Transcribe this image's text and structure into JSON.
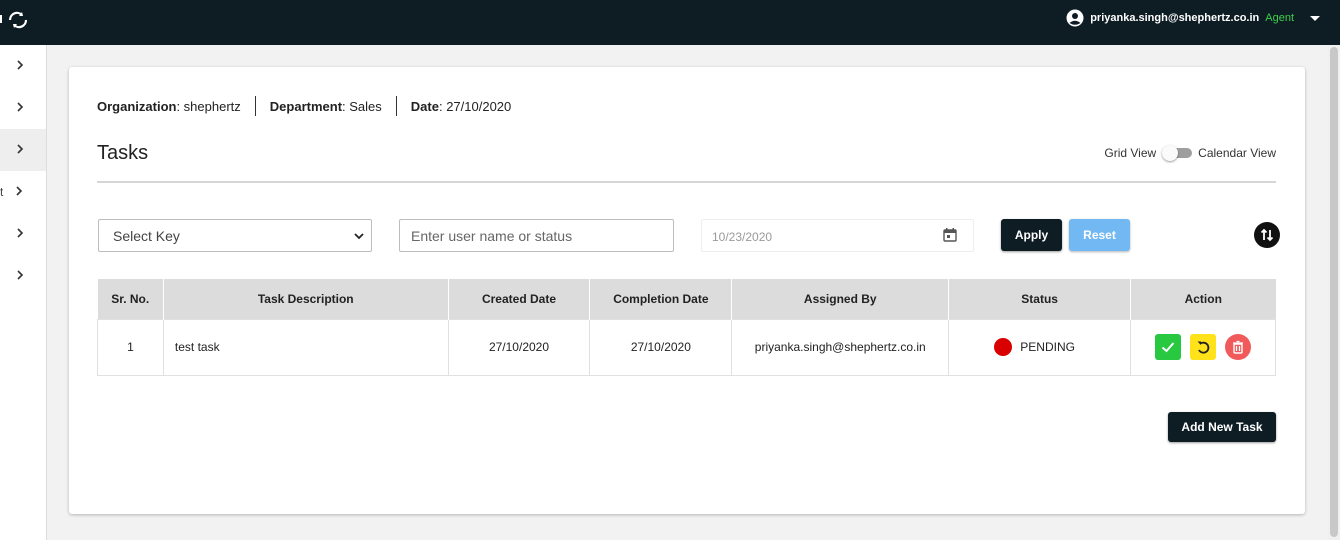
{
  "topbar": {
    "logo_icon": "sync-icon",
    "user_icon": "account-circle-icon",
    "user_email": "priyanka.singh@shephertz.co.in",
    "user_role": "Agent",
    "menu_icon": "caret-down-icon",
    "role_color": "#3ecf4c",
    "bg_color": "#0e1c24"
  },
  "sidebar": {
    "items": [
      {
        "icon": "chevron-right-icon",
        "label_fragment": "",
        "active": false
      },
      {
        "icon": "chevron-right-icon",
        "label_fragment": "",
        "active": false
      },
      {
        "icon": "chevron-right-icon",
        "label_fragment": "",
        "active": true
      },
      {
        "icon": "chevron-right-icon",
        "label_fragment": "t",
        "active": false
      },
      {
        "icon": "chevron-right-icon",
        "label_fragment": "",
        "active": false
      },
      {
        "icon": "chevron-right-icon",
        "label_fragment": "",
        "active": false
      }
    ]
  },
  "meta": {
    "org_label": "Organization",
    "org_value": ": shephertz",
    "dept_label": "Department",
    "dept_value": ": Sales",
    "date_label": "Date",
    "date_value": ": 27/10/2020"
  },
  "page": {
    "title": "Tasks",
    "view_left": "Grid View",
    "view_right": "Calendar View",
    "calendar_view_on": false
  },
  "filters": {
    "select_key": "Select Key",
    "search_placeholder": "Enter user name or status",
    "date_value": "10/23/2020",
    "apply_label": "Apply",
    "reset_label": "Reset",
    "sort_icon": "sort-swap-icon"
  },
  "table": {
    "headers": [
      "Sr. No.",
      "Task Description",
      "Created Date",
      "Completion Date",
      "Assigned By",
      "Status",
      "Action"
    ],
    "rows": [
      {
        "sr": "1",
        "description": "test task",
        "created": "27/10/2020",
        "completion": "27/10/2020",
        "assigned_by": "priyanka.singh@shephertz.co.in",
        "status": "PENDING",
        "status_color": "#d80000",
        "actions": [
          "check-icon",
          "undo-icon",
          "trash-icon"
        ]
      }
    ]
  },
  "footer": {
    "add_task_label": "Add New Task"
  },
  "colors": {
    "primary_dark": "#0e1c24",
    "reset_blue": "#72b9f3",
    "action_green": "#28c840",
    "action_yellow": "#ffe21a",
    "action_red": "#f05a5a"
  }
}
